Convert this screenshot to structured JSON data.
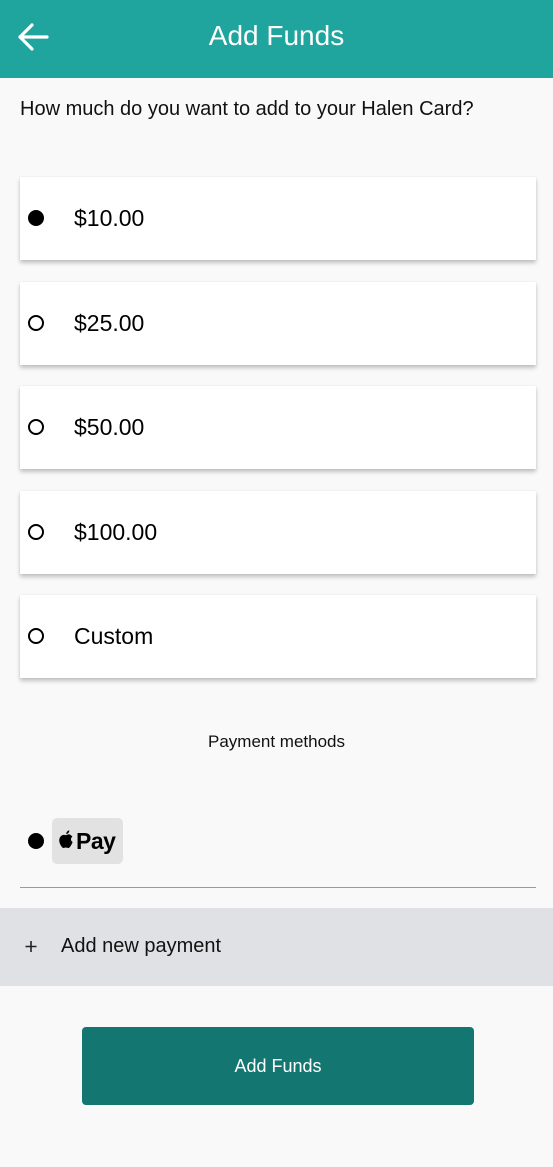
{
  "header": {
    "title": "Add Funds",
    "back_icon": "arrow-left-icon",
    "background_color": "#20a59e"
  },
  "prompt": "How much do you want to add to your Halen Card?",
  "amount_options": [
    {
      "label": "$10.00",
      "selected": true
    },
    {
      "label": "$25.00",
      "selected": false
    },
    {
      "label": "$50.00",
      "selected": false
    },
    {
      "label": "$100.00",
      "selected": false
    },
    {
      "label": "Custom",
      "selected": false
    }
  ],
  "payment": {
    "section_label": "Payment methods",
    "methods": [
      {
        "name": "Apple Pay",
        "badge_text": "Pay",
        "icon": "apple-icon",
        "selected": true
      }
    ],
    "add_new_label": "Add new payment",
    "add_icon": "plus-icon"
  },
  "submit_button": {
    "label": "Add Funds",
    "color": "#147671"
  }
}
